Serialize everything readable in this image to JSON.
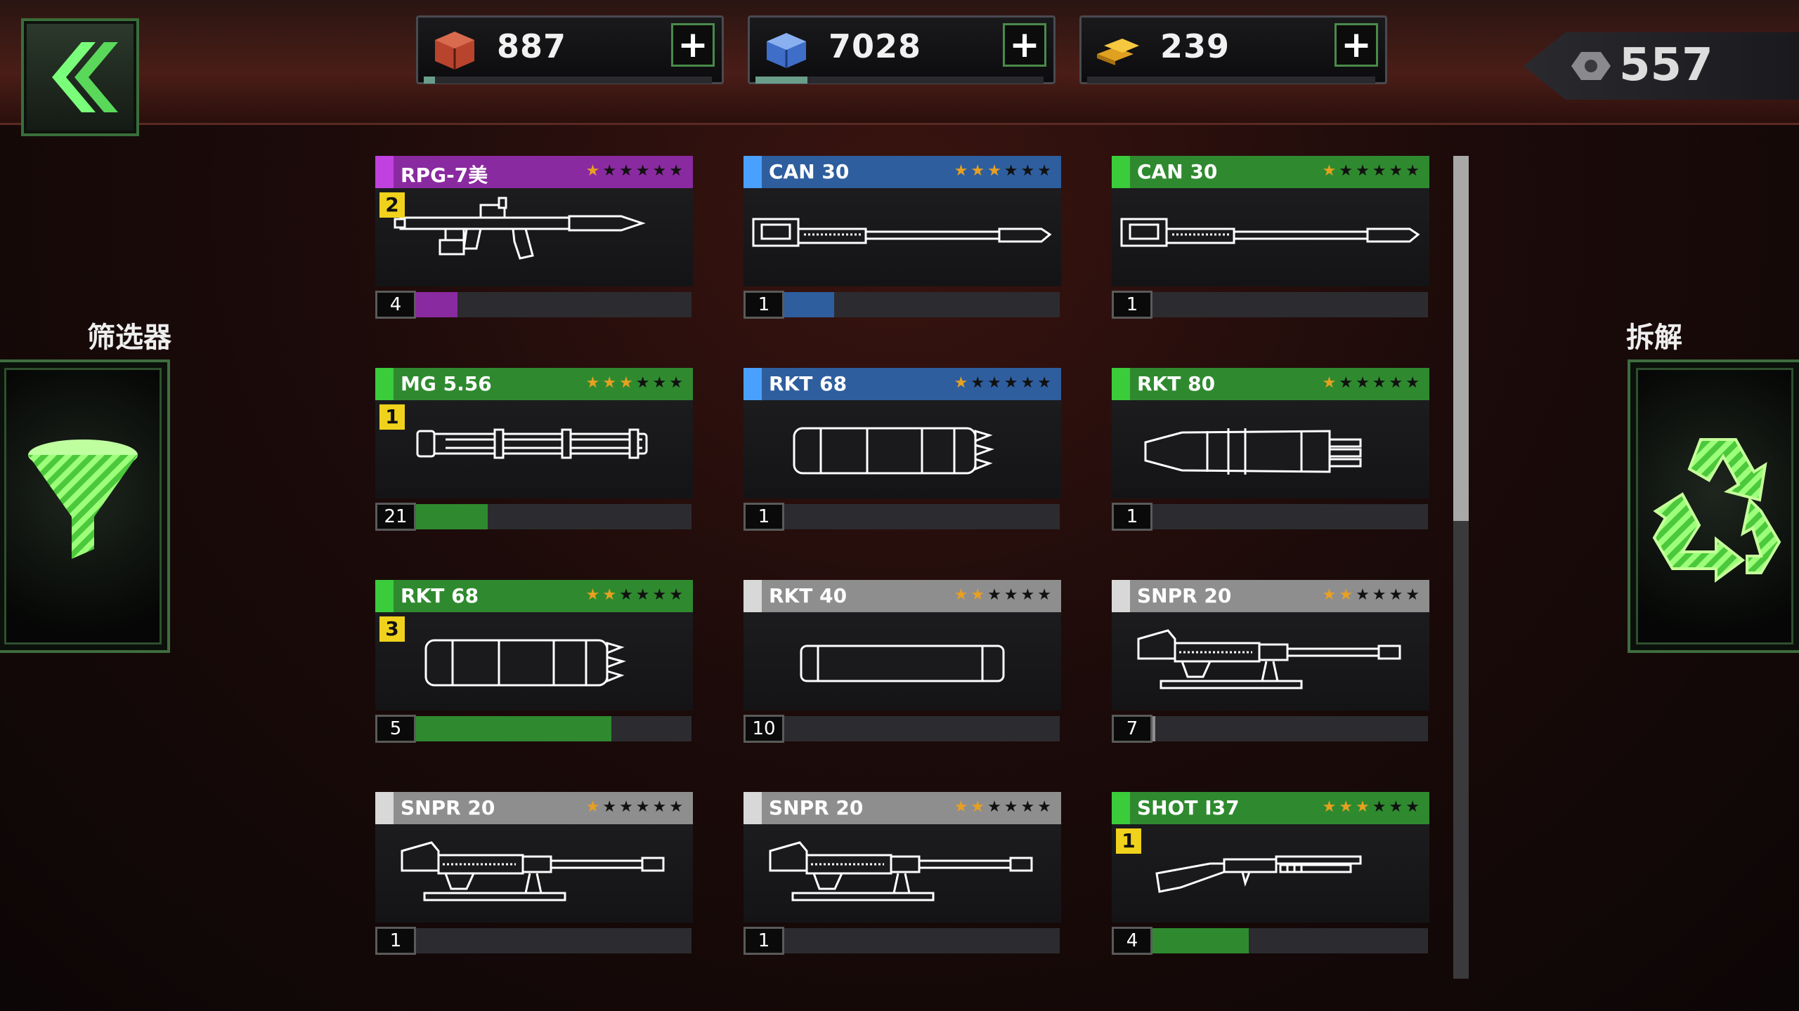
{
  "resources": [
    {
      "name": "crate-icon",
      "value": "887",
      "progress": 0.04
    },
    {
      "name": "cube-icon",
      "value": "7028",
      "progress": 0.18
    },
    {
      "name": "gold-bars-icon",
      "value": "239",
      "progress": 0.0
    }
  ],
  "plus_label": "+",
  "coins": {
    "value": "557"
  },
  "left_panel": {
    "label": "筛选器"
  },
  "right_panel": {
    "label": "拆解"
  },
  "colors": {
    "purple": "#8a2aa0",
    "blue": "#2e5e9e",
    "green": "#2f8a2f",
    "gray": "#8e8e8e",
    "star_on": "#e8a020",
    "star_off": "#bbbbbb"
  },
  "cards": [
    {
      "name": "RPG-7美",
      "rarity": "purple",
      "stars": 1,
      "badge": "2",
      "count": "4",
      "progress": 0.15,
      "weapon": "rpg"
    },
    {
      "name": "CAN 30",
      "rarity": "blue",
      "stars": 3,
      "badge": "",
      "count": "1",
      "progress": 0.18,
      "weapon": "cannon"
    },
    {
      "name": "CAN 30",
      "rarity": "green",
      "stars": 1,
      "badge": "",
      "count": "1",
      "progress": 0.0,
      "weapon": "cannon"
    },
    {
      "name": "MG 5.56",
      "rarity": "green",
      "stars": 3,
      "badge": "1",
      "count": "21",
      "progress": 0.26,
      "weapon": "minigun"
    },
    {
      "name": "RKT 68",
      "rarity": "blue",
      "stars": 1,
      "badge": "",
      "count": "1",
      "progress": 0.0,
      "weapon": "rocketpod"
    },
    {
      "name": "RKT 80",
      "rarity": "green",
      "stars": 1,
      "badge": "",
      "count": "1",
      "progress": 0.0,
      "weapon": "rocketpod2"
    },
    {
      "name": "RKT 68",
      "rarity": "green",
      "stars": 2,
      "badge": "3",
      "count": "5",
      "progress": 0.71,
      "weapon": "rocketpod"
    },
    {
      "name": "RKT 40",
      "rarity": "gray",
      "stars": 2,
      "badge": "",
      "count": "10",
      "progress": 0.0,
      "weapon": "tube"
    },
    {
      "name": "SNPR 20",
      "rarity": "gray",
      "stars": 2,
      "badge": "",
      "count": "7",
      "progress": 0.01,
      "weapon": "sniper"
    },
    {
      "name": "SNPR 20",
      "rarity": "gray",
      "stars": 1,
      "badge": "",
      "count": "1",
      "progress": 0.0,
      "weapon": "sniper"
    },
    {
      "name": "SNPR 20",
      "rarity": "gray",
      "stars": 2,
      "badge": "",
      "count": "1",
      "progress": 0.0,
      "weapon": "sniper"
    },
    {
      "name": "SHOT I37",
      "rarity": "green",
      "stars": 3,
      "badge": "1",
      "count": "4",
      "progress": 0.35,
      "weapon": "shotgun"
    }
  ]
}
